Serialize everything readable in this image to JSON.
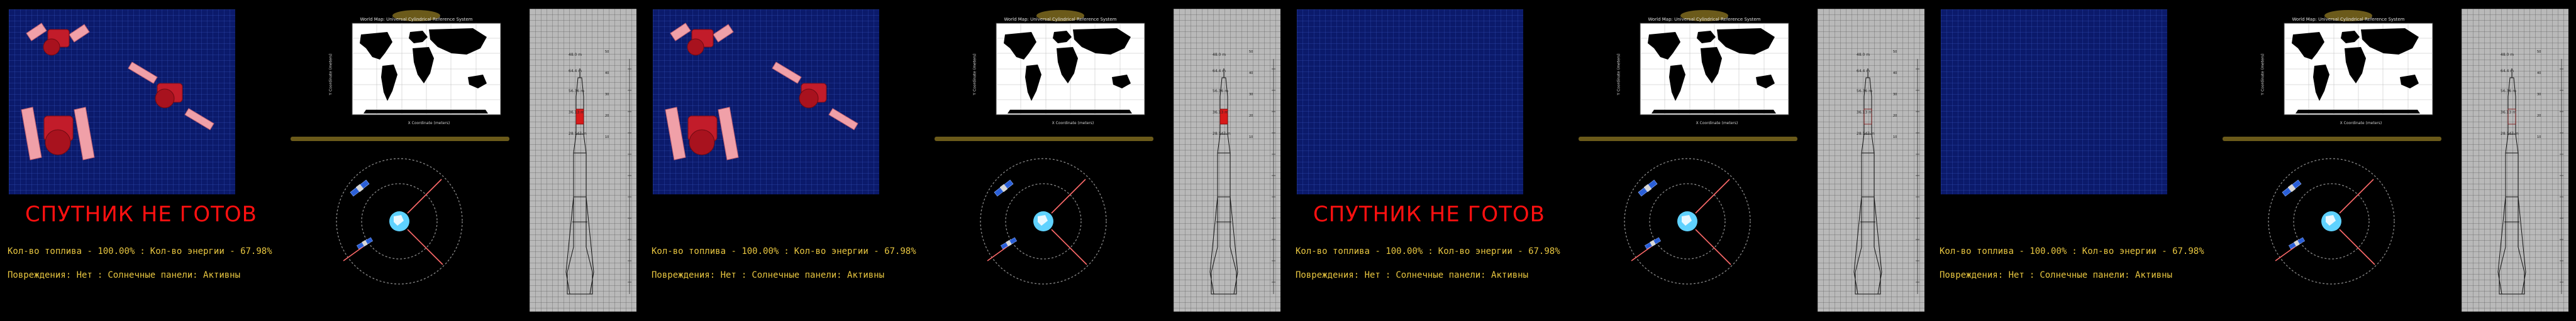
{
  "panels": [
    {
      "show_satellites": true,
      "status_text": "СПУТНИК НЕ ГОТОВ",
      "rocket_highlight": true
    },
    {
      "show_satellites": true,
      "status_text": "",
      "rocket_highlight": true
    },
    {
      "show_satellites": false,
      "status_text": "СПУТНИК НЕ ГОТОВ",
      "rocket_highlight": false
    },
    {
      "show_satellites": false,
      "status_text": "",
      "rocket_highlight": false
    }
  ],
  "telemetry": {
    "fuel_label": "Кол-во топлива",
    "fuel_value": "100.00%",
    "energy_label": "Кол-во энергии",
    "energy_value": "67.98%",
    "damage_label": "Повреждения",
    "damage_value": "Нет",
    "panels_label": "Солнечные панели",
    "panels_value": "Активны"
  },
  "map": {
    "title": "World Map: Universal Cylindrical Reference System",
    "x_axis_label": "X Coordinate (meters)",
    "y_axis_label": "Y Coordinate (meters)"
  },
  "rocket_altitudes": [
    "48.0 m",
    "64.4 m",
    "56.36 m",
    "36.13 m",
    "28.147 m"
  ],
  "colors": {
    "status": "#ff1010",
    "readout": "#e8c640",
    "viewport": "#0b1a6b",
    "orbit_line": "#ff6a6a"
  },
  "icons": [
    "satellite-icon",
    "earth-icon",
    "rocket-icon",
    "world-map"
  ]
}
